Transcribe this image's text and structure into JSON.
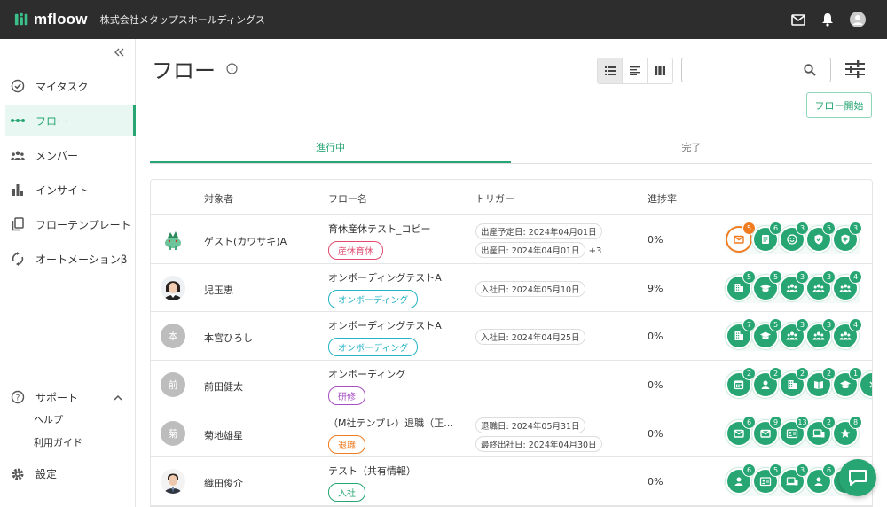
{
  "header": {
    "logo_text": "mfloow",
    "company": "株式会社メタップスホールディングス"
  },
  "sidebar": {
    "items": [
      {
        "label": "マイタスク",
        "icon": "check-circle-icon"
      },
      {
        "label": "フロー",
        "icon": "flow-dots-icon"
      },
      {
        "label": "メンバー",
        "icon": "members-icon"
      },
      {
        "label": "インサイト",
        "icon": "bar-chart-icon"
      },
      {
        "label": "フローテンプレート",
        "icon": "template-icon"
      },
      {
        "label": "オートメーションβ",
        "icon": "sync-icon"
      }
    ],
    "support": {
      "label": "サポート",
      "help": "ヘルプ",
      "guide": "利用ガイド"
    },
    "settings": "設定"
  },
  "main": {
    "title": "フロー",
    "start_button": "フロー開始",
    "tabs": [
      {
        "label": "進行中"
      },
      {
        "label": "完了"
      }
    ],
    "columns": {
      "target": "対象者",
      "flow": "フロー名",
      "trigger": "トリガー",
      "progress": "進捗率"
    }
  },
  "colors": {
    "accent": "#27a673",
    "header": "#2d2d2d",
    "alert": "#f07c22"
  },
  "rows": [
    {
      "name": "ゲスト(カワサキ)A",
      "avatar": "avatar-mascot",
      "flow": "育休産休テスト_コピー",
      "tag": "産休育休",
      "tag_color": "#e24b6e",
      "triggers": [
        "出産予定日: 2024年04月01日",
        "出産日: 2024年04月01日"
      ],
      "more": "+3",
      "progress": "0%",
      "steps": [
        {
          "icon": "mail-icon",
          "count": "5",
          "state": "alert"
        },
        {
          "icon": "document-icon",
          "count": "6"
        },
        {
          "icon": "smile-icon",
          "count": "3"
        },
        {
          "icon": "shield-icon",
          "count": "5"
        },
        {
          "icon": "shield-plus-icon",
          "count": "3"
        }
      ]
    },
    {
      "name": "児玉恵",
      "avatar": "avatar-photo-woman",
      "flow": "オンボーディングテストA",
      "tag": "オンボーディング",
      "tag_color": "#26b3c6",
      "triggers": [
        "入社日: 2024年05月10日"
      ],
      "more": "",
      "progress": "9%",
      "steps": [
        {
          "icon": "building-icon",
          "count": "5"
        },
        {
          "icon": "graduation-icon",
          "count": "5"
        },
        {
          "icon": "group-icon",
          "count": "3"
        },
        {
          "icon": "group-icon",
          "count": "3"
        },
        {
          "icon": "group-icon",
          "count": "4"
        }
      ]
    },
    {
      "name": "本宮ひろし",
      "avatar": "本",
      "flow": "オンボーディングテストA",
      "tag": "オンボーディング",
      "tag_color": "#26b3c6",
      "triggers": [
        "入社日: 2024年04月25日"
      ],
      "more": "",
      "progress": "0%",
      "steps": [
        {
          "icon": "building-icon",
          "count": "7"
        },
        {
          "icon": "graduation-icon",
          "count": "5"
        },
        {
          "icon": "group-icon",
          "count": "3"
        },
        {
          "icon": "group-icon",
          "count": "3"
        },
        {
          "icon": "group-icon",
          "count": "4"
        }
      ]
    },
    {
      "name": "前田健太",
      "avatar": "前",
      "flow": "オンボーディング",
      "tag": "研修",
      "tag_color": "#a64fc2",
      "triggers": [],
      "more": "",
      "progress": "0%",
      "steps": [
        {
          "icon": "calendar-icon",
          "count": "2"
        },
        {
          "icon": "person-icon",
          "count": "2"
        },
        {
          "icon": "building-icon",
          "count": "2"
        },
        {
          "icon": "book-icon",
          "count": "2"
        },
        {
          "icon": "graduation-icon",
          "count": "1"
        },
        {
          "icon": "more-icon",
          "count": ""
        }
      ]
    },
    {
      "name": "菊地雄星",
      "avatar": "菊",
      "flow": "（M社テンプレ）退職（正社員...",
      "tag": "退職",
      "tag_color": "#f07c22",
      "triggers": [
        "退職日: 2024年05月31日",
        "最終出社日: 2024年04月30日"
      ],
      "more": "",
      "progress": "0%",
      "steps": [
        {
          "icon": "mail-icon",
          "count": "6"
        },
        {
          "icon": "mail-icon",
          "count": "9"
        },
        {
          "icon": "id-card-icon",
          "count": "13"
        },
        {
          "icon": "devices-icon",
          "count": "2"
        },
        {
          "icon": "star-icon",
          "count": "8"
        }
      ]
    },
    {
      "name": "織田俊介",
      "avatar": "avatar-photo-man",
      "flow": "テスト（共有情報）",
      "tag": "入社",
      "tag_color": "#27a673",
      "triggers": [],
      "more": "",
      "progress": "0%",
      "steps": [
        {
          "icon": "person-icon",
          "count": "6"
        },
        {
          "icon": "id-card-icon",
          "count": "5"
        },
        {
          "icon": "devices-icon",
          "count": "3"
        },
        {
          "icon": "person-icon",
          "count": "6"
        },
        {
          "icon": "more-icon",
          "count": ""
        }
      ]
    }
  ]
}
